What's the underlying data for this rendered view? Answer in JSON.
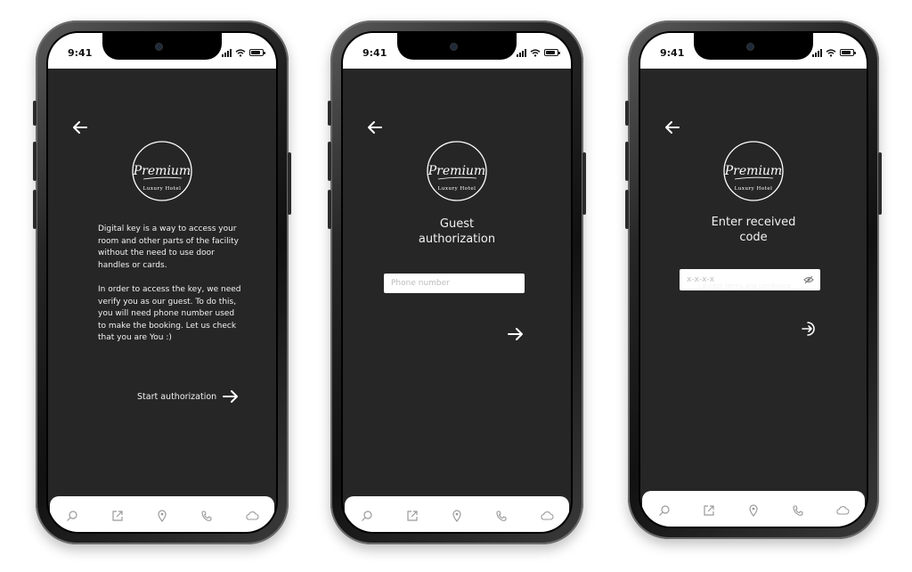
{
  "status_bar": {
    "time": "9:41"
  },
  "logo": {
    "script_text": "Premium",
    "subtitle": "Luxury Hotel"
  },
  "screen1": {
    "paragraph1": "Digital key is a way to access your room and other parts of the facility without the need to use door handles or cards.",
    "paragraph2": "In order to access the key, we need verify you as our guest. To do this, you will need phone number used to make the booking. Let us check that you are You :)",
    "start_label": "Start authorization"
  },
  "screen2": {
    "heading_line1": "Guest",
    "heading_line2": "authorization",
    "phone_placeholder": "Phone number"
  },
  "screen3": {
    "heading_line1": "Enter received",
    "heading_line2": "code",
    "code_placeholder": "x-x-x-x",
    "terms_label": "I accept terms and conditions"
  },
  "tab_bar": {
    "items": [
      "search-icon",
      "edit-external-icon",
      "location-pin-icon",
      "phone-icon",
      "cloud-icon"
    ]
  },
  "colors": {
    "screen_bg": "#262626",
    "text": "#f2f2f2",
    "tab_icon": "#9a9a9a"
  }
}
